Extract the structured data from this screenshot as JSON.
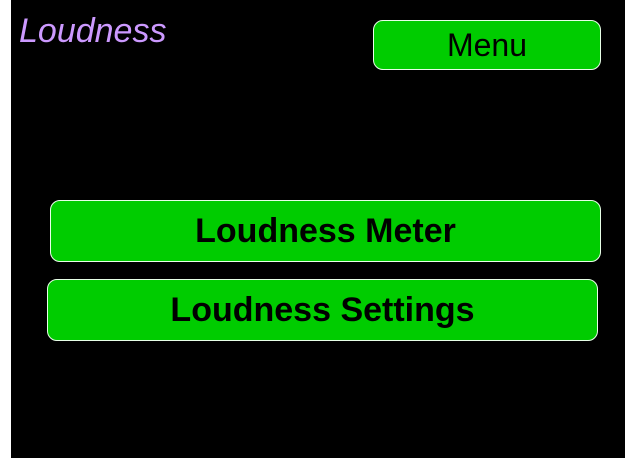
{
  "header": {
    "title": "Loudness",
    "menu_label": "Menu"
  },
  "main": {
    "buttons": [
      {
        "label": "Loudness Meter"
      },
      {
        "label": "Loudness Settings"
      }
    ]
  },
  "colors": {
    "background": "#000000",
    "title": "#cc99ff",
    "button": "#00cc00",
    "button_text": "#000000"
  }
}
